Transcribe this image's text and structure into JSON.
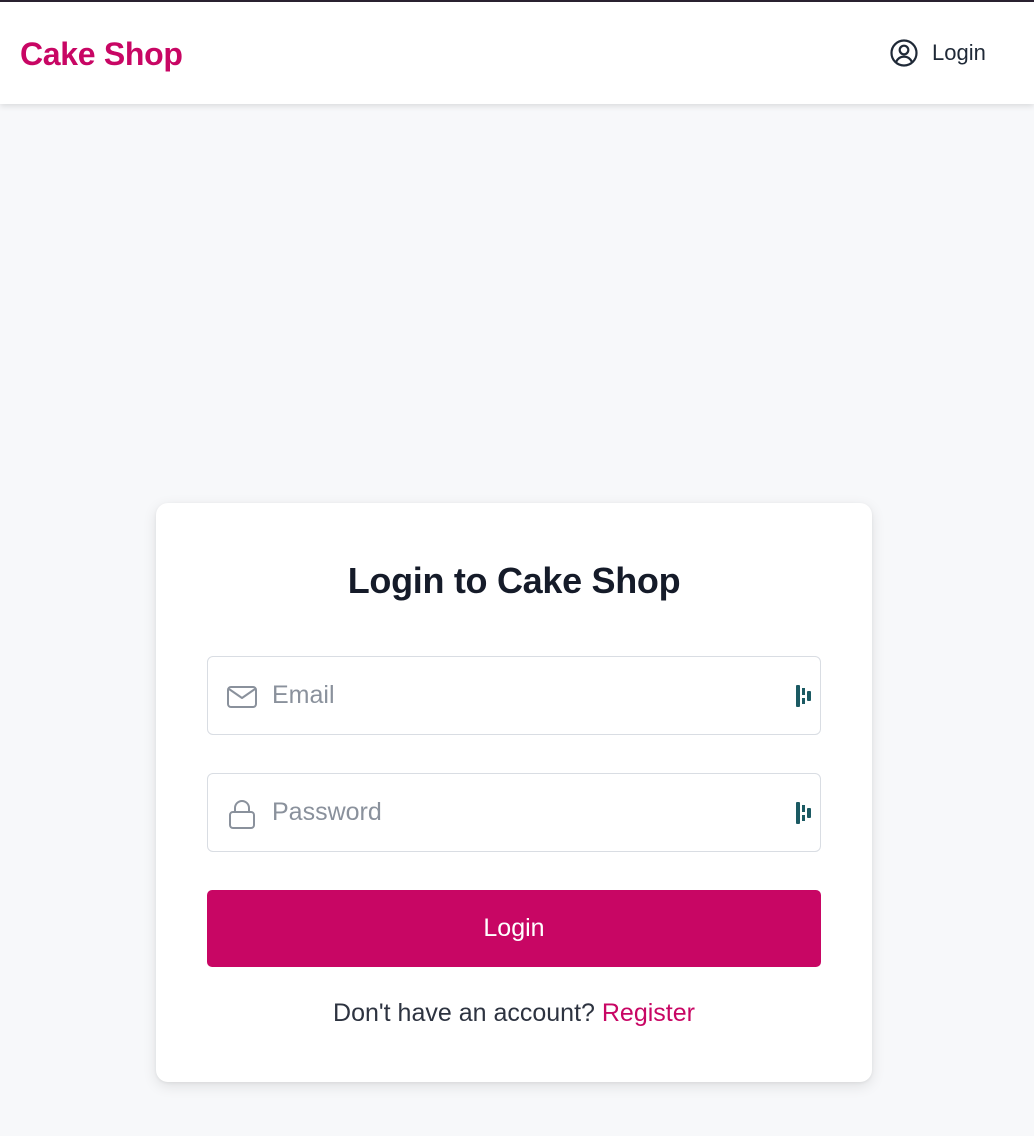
{
  "header": {
    "brand": "Cake Shop",
    "login_label": "Login"
  },
  "login_card": {
    "title": "Login to Cake Shop",
    "email": {
      "placeholder": "Email",
      "value": ""
    },
    "password": {
      "placeholder": "Password",
      "value": ""
    },
    "submit_label": "Login",
    "register_prompt": "Don't have an account? ",
    "register_link": "Register"
  },
  "icons": {
    "user": "user-circle-icon",
    "email": "envelope-icon",
    "password": "lock-icon",
    "password_manager": "password-manager-icon"
  },
  "colors": {
    "brand": "#c80664",
    "page_background": "#f7f8fa",
    "heading": "#151b29"
  }
}
